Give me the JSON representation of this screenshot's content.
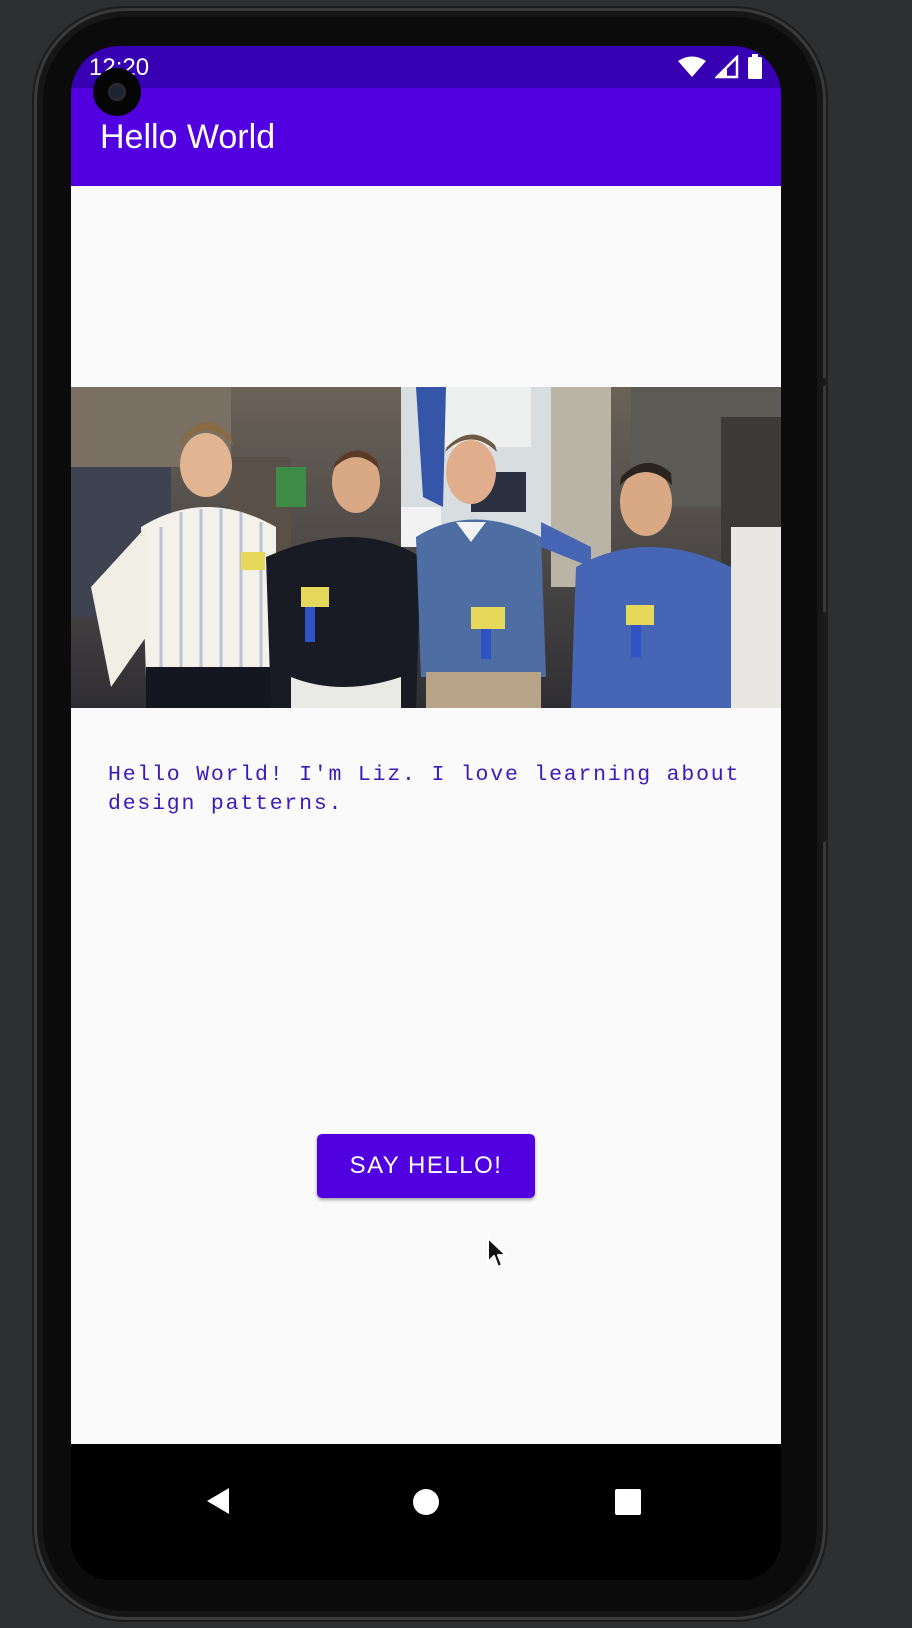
{
  "status_bar": {
    "time": "12:20",
    "icons": [
      "wifi-icon",
      "cell-signal-icon",
      "battery-icon"
    ]
  },
  "app_bar": {
    "title": "Hello World"
  },
  "main": {
    "photo_name": "group-photo",
    "message": "Hello World! I'm Liz. I love learning about design patterns.",
    "button_label": "SAY HELLO!"
  },
  "nav_bar": {
    "buttons": [
      "back-icon",
      "home-icon",
      "recents-icon"
    ]
  },
  "colors": {
    "primary": "#5100e0",
    "primary_dark": "#3700b3",
    "text_accent": "#3a1ab8",
    "background": "#fafafa"
  }
}
